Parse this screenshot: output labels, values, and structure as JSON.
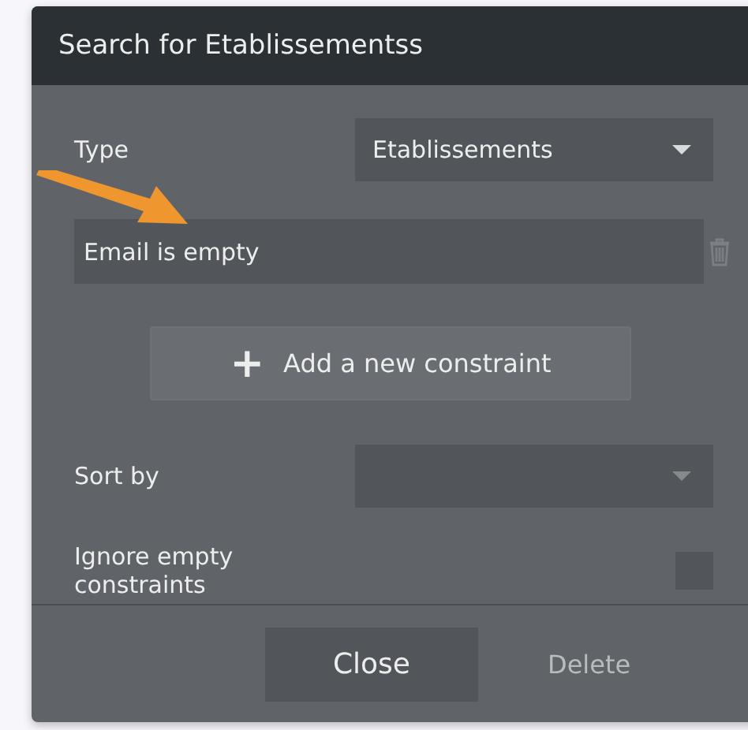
{
  "window": {
    "title": "Search for Etablissementss"
  },
  "type": {
    "label": "Type",
    "value": "Etablissements"
  },
  "constraints": [
    {
      "text": "Email is empty"
    }
  ],
  "add_button": {
    "icon": "+",
    "label": "Add a new constraint"
  },
  "sort": {
    "label": "Sort by"
  },
  "ignore_empty": {
    "label": "Ignore empty constraints",
    "checked": false
  },
  "footer": {
    "close": "Close",
    "delete": {
      "label": "Delete",
      "disabled": true
    }
  },
  "annotation": {
    "kind": "arrow"
  }
}
